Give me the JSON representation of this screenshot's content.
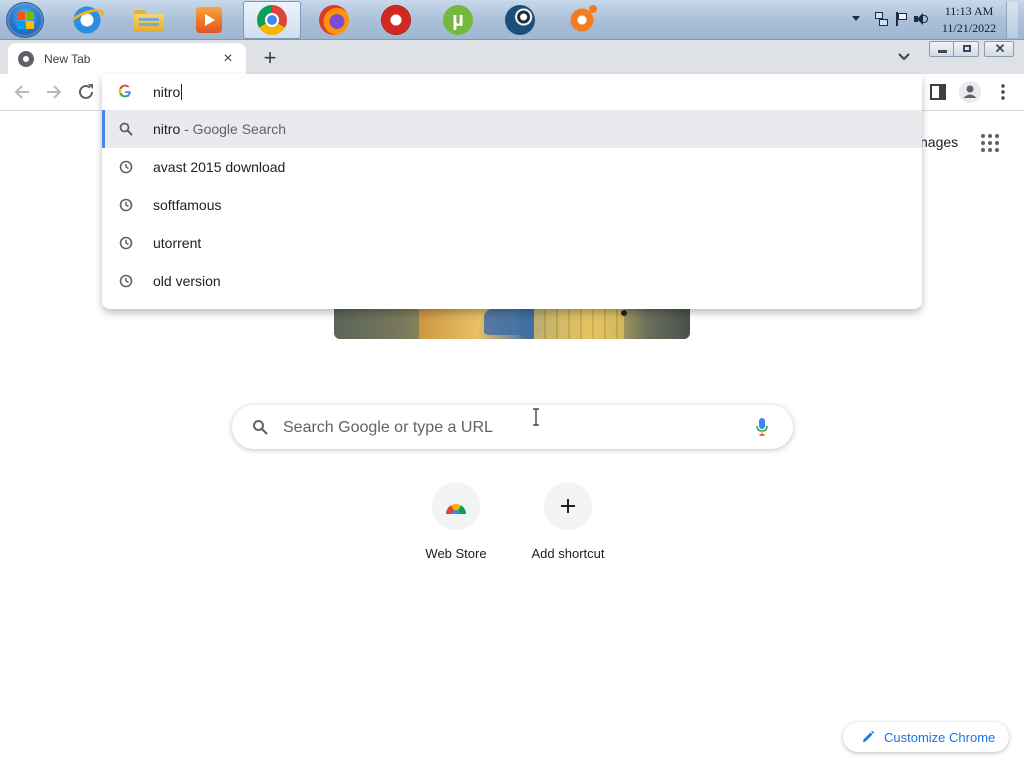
{
  "taskbar": {
    "apps": [
      {
        "name": "internet-explorer"
      },
      {
        "name": "windows-explorer"
      },
      {
        "name": "media-player"
      },
      {
        "name": "google-chrome",
        "active": true
      },
      {
        "name": "firefox"
      },
      {
        "name": "ccleaner"
      },
      {
        "name": "utorrent"
      },
      {
        "name": "steam"
      },
      {
        "name": "avast"
      }
    ],
    "clock_time": "11:13 AM",
    "clock_date": "11/21/2022"
  },
  "browser": {
    "tab_title": "New Tab",
    "tab_close": "×",
    "new_tab": "+"
  },
  "omnibox": {
    "query": "nitro",
    "suggestions": [
      {
        "text": "nitro",
        "sub": " - Google Search",
        "icon": "search-icon",
        "selected": true
      },
      {
        "text": "avast 2015 download",
        "sub": "",
        "icon": "history-icon"
      },
      {
        "text": "softfamous",
        "sub": "",
        "icon": "history-icon"
      },
      {
        "text": "utorrent",
        "sub": "",
        "icon": "history-icon"
      },
      {
        "text": "old version",
        "sub": "",
        "icon": "history-icon"
      }
    ]
  },
  "ntp": {
    "images_link_partial": "nages",
    "search_placeholder": "Search Google or type a URL",
    "shortcuts": [
      {
        "label": "Web Store"
      },
      {
        "label": "Add shortcut"
      }
    ],
    "customize_label": "Customize Chrome"
  },
  "colors": {
    "accent": "#1a73e8",
    "selected_row": "#e8eaed",
    "tabstrip": "#dee1e6"
  }
}
